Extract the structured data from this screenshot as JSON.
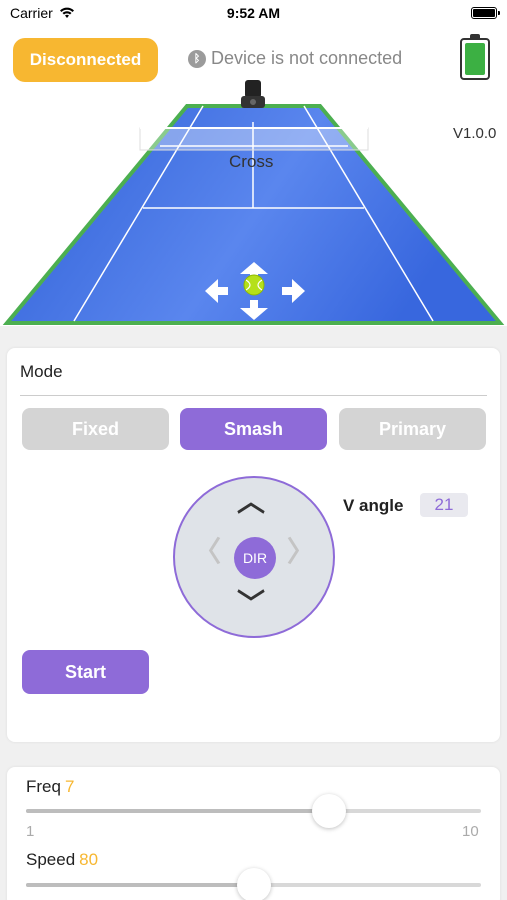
{
  "status_bar": {
    "carrier": "Carrier",
    "time": "9:52 AM"
  },
  "header": {
    "connect_button": "Disconnected",
    "device_status": "Device is not connected",
    "version": "V1.0.0"
  },
  "court": {
    "mode_label": "Cross"
  },
  "mode_panel": {
    "title": "Mode",
    "modes": [
      "Fixed",
      "Smash",
      "Primary"
    ],
    "selected_mode": "Smash",
    "dpad_center": "DIR",
    "v_angle_label": "V angle",
    "v_angle_value": "21",
    "start_button": "Start"
  },
  "sliders": {
    "freq": {
      "label": "Freq",
      "value": "7",
      "min": "1",
      "max": "10",
      "level": 0.667
    },
    "speed": {
      "label": "Speed",
      "value": "80",
      "level": 0.5
    }
  },
  "colors": {
    "accent": "#8e6bd8",
    "warning": "#f7b731",
    "court_blue": "#3f6fe0",
    "court_border": "#4caf50",
    "battery_green": "#3cb043"
  }
}
